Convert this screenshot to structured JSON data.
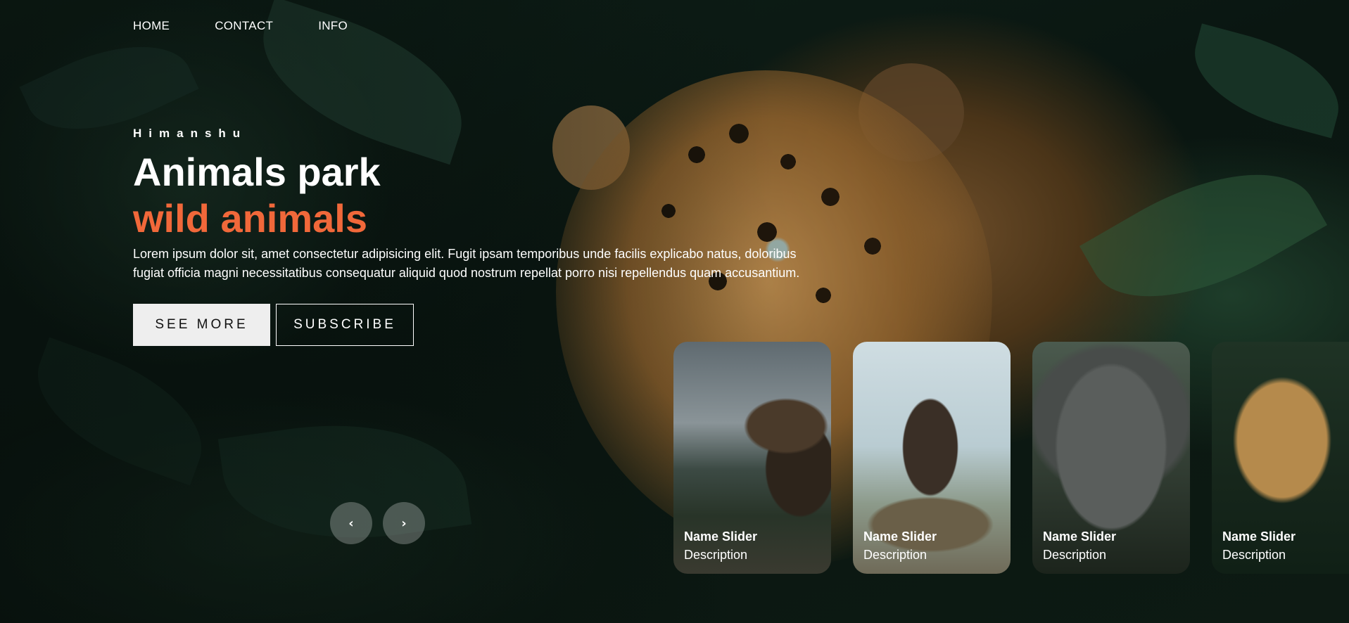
{
  "nav": {
    "items": [
      {
        "label": "HOME"
      },
      {
        "label": "CONTACT"
      },
      {
        "label": "INFO"
      }
    ]
  },
  "hero": {
    "author": "Himanshu",
    "title": "Animals park",
    "topic": "wild animals",
    "description": "Lorem ipsum dolor sit, amet consectetur adipisicing elit. Fugit ipsam temporibus unde facilis explicabo natus, doloribus fugiat officia magni necessitatibus consequatur aliquid quod nostrum repellat porro nisi repellendus quam accusantium.",
    "buttons": {
      "primary": "SEE MORE",
      "secondary": "SUBSCRIBE"
    }
  },
  "arrows": {
    "prev": "‹",
    "next": "›"
  },
  "thumbnails": [
    {
      "name": "Name Slider",
      "description": "Description",
      "icon": "moose-lake"
    },
    {
      "name": "Name Slider",
      "description": "Description",
      "icon": "moose-hill"
    },
    {
      "name": "Name Slider",
      "description": "Description",
      "icon": "elephant"
    },
    {
      "name": "Name Slider",
      "description": "Description",
      "icon": "jaguar"
    }
  ],
  "colors": {
    "accent": "#f1683a",
    "button_bg": "#eeeeee",
    "text": "#ffffff"
  }
}
